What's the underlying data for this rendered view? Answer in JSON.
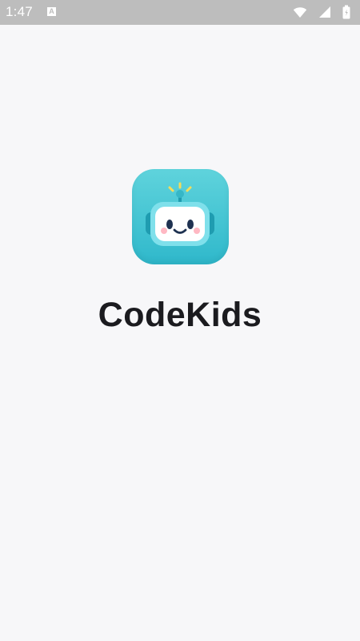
{
  "status_bar": {
    "time": "1:47",
    "notification_letter": "A",
    "icons": [
      "wifi-icon",
      "signal-icon",
      "battery-icon"
    ]
  },
  "splash": {
    "app_name": "CodeKids",
    "logo": "robot-face-icon"
  },
  "colors": {
    "background": "#f7f7f9",
    "status_bar": "#bdbdbd",
    "icon_teal_top": "#5fd3dc",
    "icon_teal_bottom": "#2fb8cb",
    "title_text": "#1b1b1f"
  }
}
